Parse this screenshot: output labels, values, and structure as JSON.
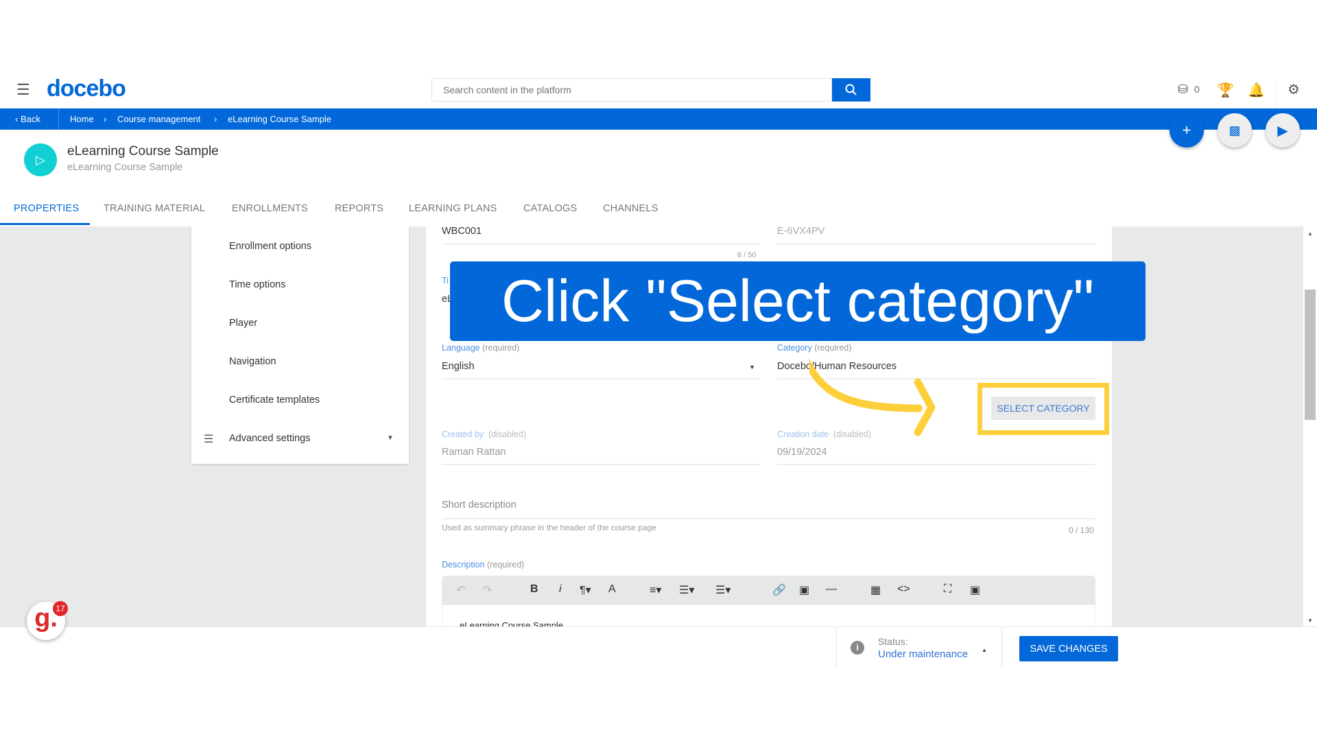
{
  "header": {
    "logo": "docebo",
    "search_placeholder": "Search content in the platform",
    "coins_count": "0",
    "icons": [
      "menu-icon",
      "search-icon",
      "coins-icon",
      "trophy-icon",
      "bell-icon",
      "gear-icon"
    ]
  },
  "breadcrumb": {
    "back": "Back",
    "items": [
      "Home",
      "Course management",
      "eLearning Course Sample"
    ]
  },
  "course": {
    "title": "eLearning Course Sample",
    "subtitle": "eLearning Course Sample"
  },
  "tabs": [
    {
      "label": "PROPERTIES",
      "active": true
    },
    {
      "label": "TRAINING MATERIAL"
    },
    {
      "label": "ENROLLMENTS"
    },
    {
      "label": "REPORTS"
    },
    {
      "label": "LEARNING PLANS"
    },
    {
      "label": "CATALOGS"
    },
    {
      "label": "CHANNELS"
    }
  ],
  "sidebar": {
    "items": [
      "Enrollment options",
      "Time options",
      "Player",
      "Navigation",
      "Certificate templates",
      "Advanced settings"
    ]
  },
  "form": {
    "code_value": "WBC001",
    "code_counter": "6 / 50",
    "uid_value": "E-6VX4PV",
    "title_label_partial": "Ti",
    "title_value_partial": "eL",
    "language_label": "Language",
    "language_req": "(required)",
    "language_value": "English",
    "category_label": "Category",
    "category_req": "(required)",
    "category_value": "Docebo/Human Resources",
    "select_category": "SELECT CATEGORY",
    "created_by_label": "Created by",
    "created_by_note": "(disabled)",
    "created_by_value": "Raman Rattan",
    "creation_date_label": "Creation date",
    "creation_date_note": "(disabled)",
    "creation_date_value": "09/19/2024",
    "short_desc_placeholder": "Short description",
    "short_desc_hint": "Used as summary phrase in the header of the course page",
    "short_desc_counter": "0 / 130",
    "description_label": "Description",
    "description_req": "(required)",
    "description_value": "eLearning Course Sample"
  },
  "footer": {
    "status_label": "Status:",
    "status_value": "Under maintenance",
    "save": "SAVE CHANGES"
  },
  "overlay": {
    "instruction": "Click \"Select category\"",
    "banner_color": "#0268d9",
    "highlight_color": "#fdd03b"
  },
  "badge": {
    "count": "17"
  }
}
